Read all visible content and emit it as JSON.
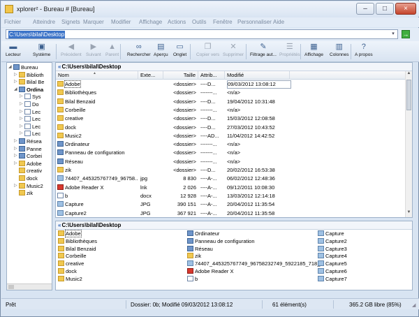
{
  "window": {
    "title": "xplorer² - Bureau # [Bureau]",
    "minimize_glyph": "–",
    "maximize_glyph": "□",
    "close_glyph": "×"
  },
  "menu": [
    "Fichier",
    "Atteindre",
    "Signets",
    "Marquer",
    "Modifier",
    "Affichage",
    "Actions",
    "Outils",
    "Fenêtre",
    "Personnaliser",
    "Aide"
  ],
  "address": {
    "value": "C:\\Users\\bilal\\Desktop",
    "go_glyph": "→",
    "dropdown_glyph": "▾"
  },
  "toolbar": [
    {
      "label": "Lecteur",
      "icon": "drive-icon",
      "glyph": "▬",
      "enabled": true
    },
    {
      "label": "Système",
      "icon": "monitor-icon",
      "glyph": "▣",
      "enabled": true
    },
    {
      "label": "Précédent",
      "icon": "back-icon",
      "glyph": "◀",
      "enabled": false
    },
    {
      "label": "Suivant",
      "icon": "forward-icon",
      "glyph": "▶",
      "enabled": false
    },
    {
      "label": "Parent",
      "icon": "up-icon",
      "glyph": "▲",
      "enabled": false
    },
    {
      "label": "Rechercher",
      "icon": "binoculars-icon",
      "glyph": "∞",
      "enabled": true
    },
    {
      "label": "Aperçu",
      "icon": "preview-icon",
      "glyph": "▤",
      "enabled": true
    },
    {
      "label": "Onglet",
      "icon": "tab-icon",
      "glyph": "▭",
      "enabled": true
    },
    {
      "label": "Copier vers",
      "icon": "copy-icon",
      "glyph": "❐",
      "enabled": false
    },
    {
      "label": "Supprimer",
      "icon": "delete-icon",
      "glyph": "✕",
      "enabled": false
    },
    {
      "label": "Filtrage aut...",
      "icon": "filter-icon",
      "glyph": "✎",
      "enabled": true
    },
    {
      "label": "Propriétés",
      "icon": "properties-icon",
      "glyph": "☰",
      "enabled": false
    },
    {
      "label": "Affichage",
      "icon": "view-icon",
      "glyph": "▦",
      "enabled": true
    },
    {
      "label": "Colonnes",
      "icon": "columns-icon",
      "glyph": "▥",
      "enabled": true
    },
    {
      "label": "A propos",
      "icon": "help-icon",
      "glyph": "?",
      "enabled": true
    }
  ],
  "tree": [
    {
      "label": "Bureau",
      "type": "blue",
      "expander": "◢"
    },
    {
      "label": "Biblioth",
      "type": "folder",
      "expander": "▷"
    },
    {
      "label": "Bilal Be",
      "type": "folder",
      "expander": "▷"
    },
    {
      "label": "Ordina",
      "type": "blue",
      "expander": "◢",
      "bold": true
    },
    {
      "label": "Sys",
      "type": "drive",
      "expander": "▷"
    },
    {
      "label": "Do",
      "type": "drive",
      "expander": "▷"
    },
    {
      "label": "Lec",
      "type": "drive",
      "expander": "▷"
    },
    {
      "label": "Lec",
      "type": "drive",
      "expander": "▷"
    },
    {
      "label": "Lec",
      "type": "drive",
      "expander": "▷"
    },
    {
      "label": "Lec",
      "type": "drive",
      "expander": "▷"
    },
    {
      "label": "Résea",
      "type": "blue",
      "expander": "▷"
    },
    {
      "label": "Panne",
      "type": "blue",
      "expander": "▷"
    },
    {
      "label": "Corbei",
      "type": "blue",
      "expander": "▷"
    },
    {
      "label": "Adobe",
      "type": "folder",
      "expander": "▷"
    },
    {
      "label": "creativ",
      "type": "folder",
      "expander": ""
    },
    {
      "label": "dock",
      "type": "folder",
      "expander": ""
    },
    {
      "label": "Music2",
      "type": "folder",
      "expander": "▷"
    },
    {
      "label": "zik",
      "type": "folder",
      "expander": ""
    }
  ],
  "top_pane": {
    "path": "C:\\Users\\bilal\\Desktop",
    "path_arrow": "«",
    "columns": [
      "Nom",
      "Exte...",
      "Taille",
      "Attrib...",
      "Modifié"
    ],
    "sort_glyph": "▲",
    "rows": [
      {
        "name": "Adobe",
        "ext": "",
        "size": "<dossier>",
        "attr": "----D...",
        "modified": "09/03/2012 13:08:12",
        "type": "folder",
        "selected": true
      },
      {
        "name": "Bibliothèques",
        "ext": "",
        "size": "<dossier>",
        "attr": "-------...",
        "modified": "<n/a>",
        "type": "folder"
      },
      {
        "name": "Bilal Benzaid",
        "ext": "",
        "size": "<dossier>",
        "attr": "----D...",
        "modified": "19/04/2012 10:31:48",
        "type": "folder"
      },
      {
        "name": "Corbeille",
        "ext": "",
        "size": "<dossier>",
        "attr": "-------...",
        "modified": "<n/a>",
        "type": "folder"
      },
      {
        "name": "creative",
        "ext": "",
        "size": "<dossier>",
        "attr": "----D...",
        "modified": "15/03/2012 12:08:58",
        "type": "folder"
      },
      {
        "name": "dock",
        "ext": "",
        "size": "<dossier>",
        "attr": "----D...",
        "modified": "27/03/2012 10:43:52",
        "type": "folder"
      },
      {
        "name": "Music2",
        "ext": "",
        "size": "<dossier>",
        "attr": "----AD...",
        "modified": "11/04/2012 14:42:52",
        "type": "folder"
      },
      {
        "name": "Ordinateur",
        "ext": "",
        "size": "<dossier>",
        "attr": "-------...",
        "modified": "<n/a>",
        "type": "blue"
      },
      {
        "name": "Panneau de configuration",
        "ext": "",
        "size": "<dossier>",
        "attr": "-------...",
        "modified": "<n/a>",
        "type": "blue"
      },
      {
        "name": "Réseau",
        "ext": "",
        "size": "<dossier>",
        "attr": "-------...",
        "modified": "<n/a>",
        "type": "blue"
      },
      {
        "name": "zik",
        "ext": "",
        "size": "<dossier>",
        "attr": "----D...",
        "modified": "20/02/2012 16:53:38",
        "type": "folder"
      },
      {
        "name": "74407_445325767749_96758...",
        "ext": "jpg",
        "size": "8 830",
        "attr": "----A-...",
        "modified": "06/02/2012 12:48:36",
        "type": "img"
      },
      {
        "name": "Adobe Reader X",
        "ext": "lnk",
        "size": "2 026",
        "attr": "----A-...",
        "modified": "09/12/2011 10:08:30",
        "type": "pdf"
      },
      {
        "name": "b",
        "ext": "docx",
        "size": "12 928",
        "attr": "----A-...",
        "modified": "13/03/2012 12:14:18",
        "type": "doc"
      },
      {
        "name": "Capture",
        "ext": "JPG",
        "size": "390 151",
        "attr": "----A-...",
        "modified": "20/04/2012 11:35:54",
        "type": "img"
      },
      {
        "name": "Capture2",
        "ext": "JPG",
        "size": "367 921",
        "attr": "----A-...",
        "modified": "20/04/2012 11:35:58",
        "type": "img"
      }
    ]
  },
  "bottom_pane": {
    "path": "C:\\Users\\bilal\\Desktop",
    "path_arrow": "«",
    "col1": [
      {
        "label": "Adobe",
        "type": "folder",
        "selected": true
      },
      {
        "label": "Bibliothèques",
        "type": "folder"
      },
      {
        "label": "Bilal Benzaid",
        "type": "folder"
      },
      {
        "label": "Corbeille",
        "type": "folder"
      },
      {
        "label": "creative",
        "type": "folder"
      },
      {
        "label": "dock",
        "type": "folder"
      },
      {
        "label": "Music2",
        "type": "folder"
      }
    ],
    "col2": [
      {
        "label": "Ordinateur",
        "type": "blue"
      },
      {
        "label": "Panneau de configuration",
        "type": "blue"
      },
      {
        "label": "Réseau",
        "type": "blue"
      },
      {
        "label": "zik",
        "type": "folder"
      },
      {
        "label": "74407_445325767749_96758232749_5922185_718_n",
        "type": "img"
      },
      {
        "label": "Adobe Reader X",
        "type": "pdf"
      },
      {
        "label": "b",
        "type": "doc"
      }
    ],
    "col3": [
      {
        "label": "Capture",
        "type": "img"
      },
      {
        "label": "Capture2",
        "type": "img"
      },
      {
        "label": "Capture3",
        "type": "img"
      },
      {
        "label": "Capture4",
        "type": "img"
      },
      {
        "label": "Capture5",
        "type": "img"
      },
      {
        "label": "Capture6",
        "type": "img"
      },
      {
        "label": "Capture7",
        "type": "img"
      }
    ]
  },
  "status": {
    "ready": "Prêt",
    "info": "Dossier: 0b; Modifié 09/03/2012 13:08:12",
    "count": "61 élément(s)",
    "free": "365.2 GB libre (85%)",
    "grip_glyph": "◢"
  },
  "colors": {
    "accent": "#3b73c8",
    "folder": "#f0c850",
    "frame": "#d8e4f2"
  }
}
